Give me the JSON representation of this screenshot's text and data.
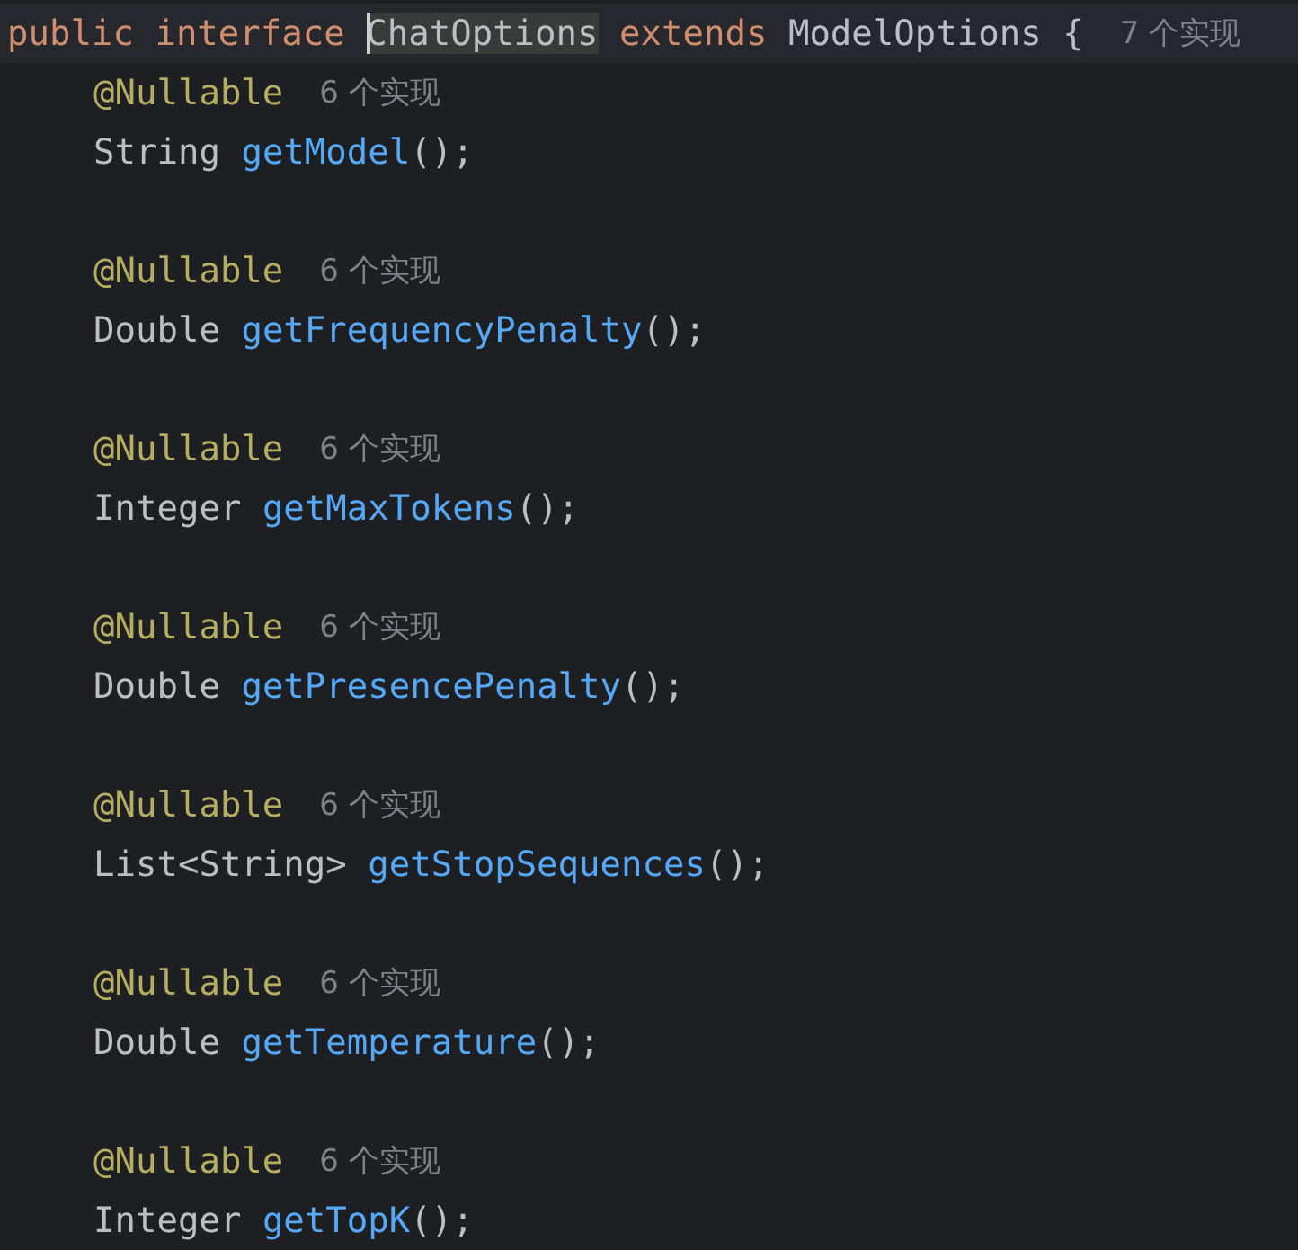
{
  "header": {
    "current_line": true,
    "tokens": [
      {
        "text": "public",
        "kind": "keyword"
      },
      {
        "text": "interface",
        "kind": "keyword"
      },
      {
        "text": "ChatOptions",
        "kind": "usage",
        "caret": true
      },
      {
        "text": "extends",
        "kind": "keyword"
      },
      {
        "text": "ModelOptions",
        "kind": "plain"
      },
      {
        "text": "{",
        "kind": "plain"
      }
    ],
    "hint": "7 个实现"
  },
  "members": [
    {
      "annotation": "@Nullable",
      "hint": "6 个实现",
      "return_type": "String",
      "method": "getModel",
      "tail": "();"
    },
    {
      "annotation": "@Nullable",
      "hint": "6 个实现",
      "return_type": "Double",
      "method": "getFrequencyPenalty",
      "tail": "();"
    },
    {
      "annotation": "@Nullable",
      "hint": "6 个实现",
      "return_type": "Integer",
      "method": "getMaxTokens",
      "tail": "();"
    },
    {
      "annotation": "@Nullable",
      "hint": "6 个实现",
      "return_type": "Double",
      "method": "getPresencePenalty",
      "tail": "();"
    },
    {
      "annotation": "@Nullable",
      "hint": "6 个实现",
      "return_type": "List<String>",
      "method": "getStopSequences",
      "tail": "();"
    },
    {
      "annotation": "@Nullable",
      "hint": "6 个实现",
      "return_type": "Double",
      "method": "getTemperature",
      "tail": "();"
    },
    {
      "annotation": "@Nullable",
      "hint": "6 个实现",
      "return_type": "Integer",
      "method": "getTopK",
      "tail": "();"
    }
  ]
}
